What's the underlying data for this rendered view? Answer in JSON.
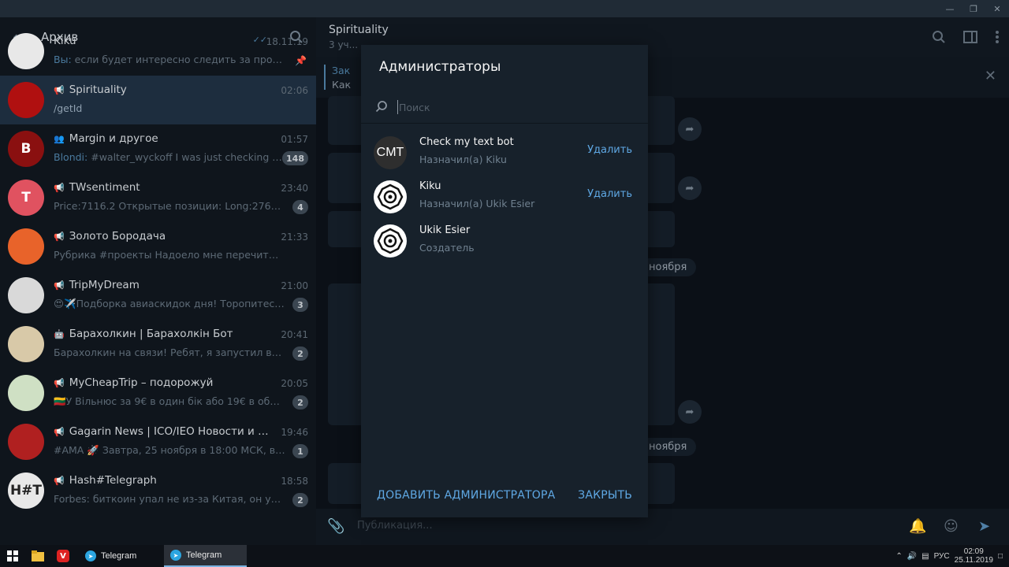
{
  "left_panel": {
    "title": "Архив",
    "chats": [
      {
        "name": "Kiku",
        "time": "18.11.19",
        "sender": "Вы: ",
        "preview": "если будет интересно следить за проекто...",
        "pinned": true,
        "avatar_text": "",
        "avatar_color": "#e8e8e8"
      },
      {
        "name": "Spirituality",
        "time": "02:06",
        "preview": "/getId",
        "channel": true,
        "active": true,
        "avatar_text": "",
        "avatar_color": "#b01010"
      },
      {
        "name": "Margin и другое",
        "time": "01:57",
        "sender": "Blondi: ",
        "preview": "#walter_wyckoff  I was just checking M...",
        "group": true,
        "badge": "148",
        "avatar_text": "B",
        "avatar_color": "#8a1010"
      },
      {
        "name": "TWsentiment",
        "time": "23:40",
        "preview": "Price:7116.2 Открытые позиции: Long:27607 B...",
        "channel": true,
        "badge": "4",
        "avatar_text": "T",
        "avatar_color": "#e05260"
      },
      {
        "name": "Золото Бородача",
        "time": "21:33",
        "preview": "Рубрика #проекты  Надоело мне перечитывать с...",
        "channel": true,
        "avatar_text": "",
        "avatar_color": "#e8632a"
      },
      {
        "name": "TripMyDream",
        "time": "21:00",
        "preview": "😍✈️Подборка авиаскидок дня! Торопитесь, ...",
        "channel": true,
        "badge": "3",
        "avatar_text": "",
        "avatar_color": "#d9d9d9"
      },
      {
        "name": "Барахолкин | Барахолкін Бот",
        "time": "20:41",
        "preview": "Барахолкин на связи! Ребят, я запустил возмо...",
        "bot": true,
        "badge": "2",
        "avatar_text": "",
        "avatar_color": "#d8c9a8"
      },
      {
        "name": "MyCheapTrip – подорожуй",
        "time": "20:05",
        "preview": "🇱🇹У Вільнюс за 9€ в один бік або 19€ в обидв...",
        "channel": true,
        "badge": "2",
        "avatar_text": "",
        "avatar_color": "#cfe0c4"
      },
      {
        "name": "Gagarin News | ICO/IEO Новости и Обзо...",
        "time": "19:46",
        "preview": "#AMA 🚀  Завтра, 25 ноября в 18:00 МСК, в на...",
        "channel": true,
        "badge": "1",
        "avatar_text": "",
        "avatar_color": "#b02020"
      },
      {
        "name": "Hash#Telegraph",
        "time": "18:58",
        "preview": "Forbes: биткоин упал не из-за Китая, он упал, ...",
        "channel": true,
        "badge": "2",
        "avatar_text": "H#T",
        "avatar_color": "#e8e8e8"
      }
    ]
  },
  "right_panel": {
    "title": "Spirituality",
    "subtitle": "3 уч...",
    "pinned_label": "Зак",
    "pinned_text": "Как",
    "dates": [
      "ноября",
      "ноября"
    ],
    "composer_placeholder": "Публикация..."
  },
  "modal": {
    "title": "Администраторы",
    "search_placeholder": "Поиск",
    "admins": [
      {
        "name": "Check my text bot",
        "role": "Назначил(а) Kiku",
        "avatar_text": "CMT",
        "avatar_color": "#2e2e2e",
        "remove_label": "Удалить"
      },
      {
        "name": "Kiku",
        "role": "Назначил(а) Ukik Esier",
        "avatar_text": "",
        "avatar_color": "#ffffff",
        "remove_label": "Удалить"
      },
      {
        "name": "Ukik Esier",
        "role": "Создатель",
        "avatar_text": "",
        "avatar_color": "#ffffff",
        "remove_label": ""
      }
    ],
    "add_button": "ДОБАВИТЬ АДМИНИСТРАТОРА",
    "close_button": "ЗАКРЫТЬ"
  },
  "taskbar": {
    "apps": [
      {
        "label": "Telegram"
      },
      {
        "label": "Telegram"
      }
    ],
    "lang": "РУС",
    "time": "02:09",
    "date": "25.11.2019"
  },
  "colors": {
    "accent": "#5fa8e4",
    "modal_bg": "#17212b",
    "dim_bg": "#0f151c"
  }
}
